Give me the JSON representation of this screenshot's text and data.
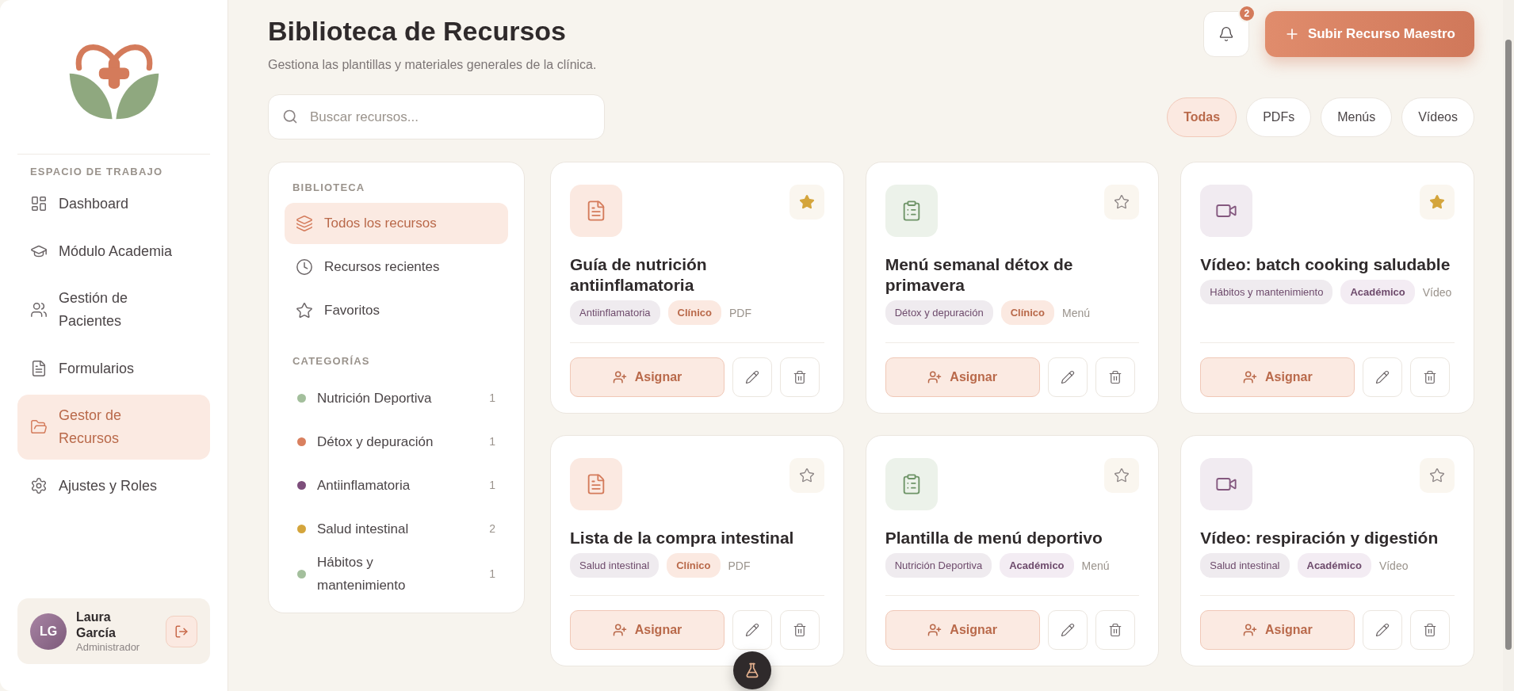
{
  "sidebar": {
    "section_label": "ESPACIO DE TRABAJO",
    "nav": [
      {
        "label": "Dashboard",
        "selected": false
      },
      {
        "label": "Módulo Academia",
        "selected": false
      },
      {
        "label": "Gestión de Pacientes",
        "selected": false
      },
      {
        "label": "Formularios",
        "selected": false
      },
      {
        "label": "Gestor de Recursos",
        "selected": true
      },
      {
        "label": "Ajustes y Roles",
        "selected": false
      }
    ],
    "user": {
      "initials": "LG",
      "name": "Laura García",
      "role": "Administrador"
    }
  },
  "header": {
    "title": "Biblioteca de Recursos",
    "subtitle": "Gestiona las plantillas y materiales generales de la clínica.",
    "notification_count": "2",
    "upload_button": "Subir Recurso Maestro"
  },
  "search": {
    "placeholder": "Buscar recursos..."
  },
  "filters": [
    {
      "label": "Todas",
      "selected": true
    },
    {
      "label": "PDFs",
      "selected": false
    },
    {
      "label": "Menús",
      "selected": false
    },
    {
      "label": "Vídeos",
      "selected": false
    }
  ],
  "library": {
    "heading": "BIBLIOTECA",
    "items": [
      {
        "label": "Todos los recursos",
        "selected": true
      },
      {
        "label": "Recursos recientes",
        "selected": false
      },
      {
        "label": "Favoritos",
        "selected": false
      }
    ],
    "categories_heading": "CATEGORÍAS",
    "categories": [
      {
        "label": "Nutrición Deportiva",
        "count": "1",
        "color": "#a3bf9c"
      },
      {
        "label": "Détox y depuración",
        "count": "1",
        "color": "#d9805f"
      },
      {
        "label": "Antiinflamatoria",
        "count": "1",
        "color": "#7d4e7b"
      },
      {
        "label": "Salud intestinal",
        "count": "2",
        "color": "#d4a53c"
      },
      {
        "label": "Hábitos y mantenimiento",
        "count": "1",
        "color": "#a3bf9c"
      }
    ]
  },
  "cards": [
    {
      "kind": "pdf",
      "title": "Guía de nutrición antiinflamatoria",
      "favorite": true,
      "tags": [
        {
          "label": "Antiinflamatoria",
          "kind": "category"
        },
        {
          "label": "Clínico",
          "kind": "clinical"
        }
      ],
      "format": "PDF",
      "assign": "Asignar"
    },
    {
      "kind": "menu",
      "title": "Menú semanal détox de primavera",
      "favorite": false,
      "tags": [
        {
          "label": "Détox y depuración",
          "kind": "category"
        },
        {
          "label": "Clínico",
          "kind": "clinical"
        }
      ],
      "format": "Menú",
      "assign": "Asignar"
    },
    {
      "kind": "video",
      "title": "Vídeo: batch cooking saludable",
      "favorite": true,
      "tags": [
        {
          "label": "Hábitos y mantenimiento",
          "kind": "category"
        },
        {
          "label": "Académico",
          "kind": "academic"
        }
      ],
      "format": "Vídeo",
      "assign": "Asignar"
    },
    {
      "kind": "pdf",
      "title": "Lista de la compra intestinal",
      "favorite": false,
      "tags": [
        {
          "label": "Salud intestinal",
          "kind": "category"
        },
        {
          "label": "Clínico",
          "kind": "clinical"
        }
      ],
      "format": "PDF",
      "assign": "Asignar"
    },
    {
      "kind": "menu",
      "title": "Plantilla de menú deportivo",
      "favorite": false,
      "tags": [
        {
          "label": "Nutrición Deportiva",
          "kind": "category"
        },
        {
          "label": "Académico",
          "kind": "academic"
        }
      ],
      "format": "Menú",
      "assign": "Asignar"
    },
    {
      "kind": "video",
      "title": "Vídeo: respiración y digestión",
      "favorite": false,
      "tags": [
        {
          "label": "Salud intestinal",
          "kind": "category"
        },
        {
          "label": "Académico",
          "kind": "academic"
        }
      ],
      "format": "Vídeo",
      "assign": "Asignar"
    }
  ]
}
